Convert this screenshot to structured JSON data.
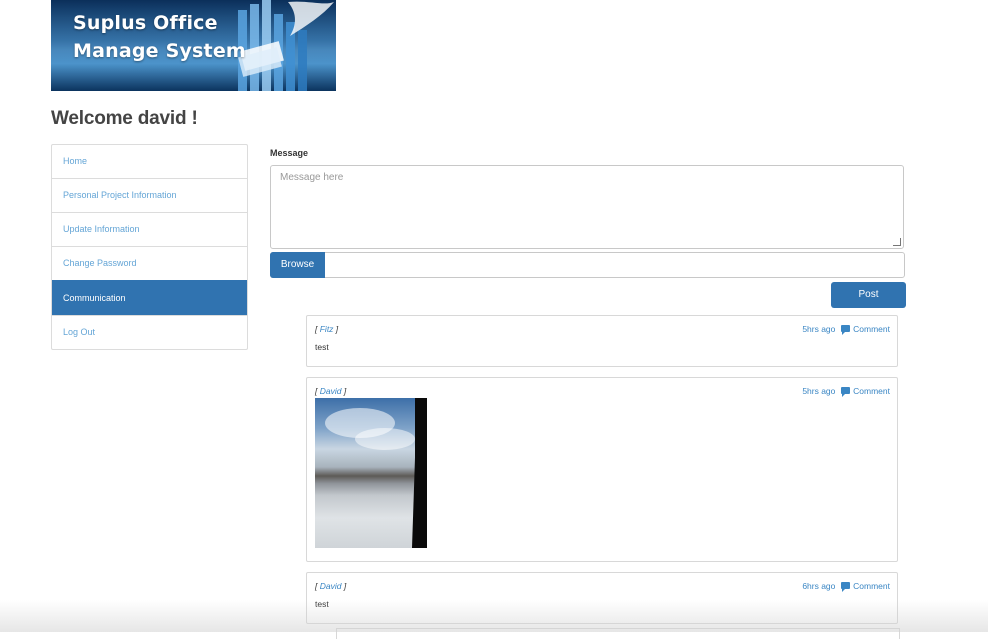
{
  "banner": {
    "line1": "Suplus Office",
    "line2": "Manage System"
  },
  "welcome": "Welcome david !",
  "sidebar": {
    "items": [
      {
        "label": "Home"
      },
      {
        "label": "Personal Project Information"
      },
      {
        "label": "Update Information"
      },
      {
        "label": "Change Password"
      },
      {
        "label": "Communication",
        "active": true
      },
      {
        "label": "Log Out"
      }
    ]
  },
  "form": {
    "message_label": "Message",
    "message_placeholder": "Message here",
    "browse_label": "Browse",
    "post_label": "Post"
  },
  "posts": [
    {
      "bracket_open": "[ ",
      "author": "Fitz",
      "bracket_close": " ]",
      "time": "5hrs ago",
      "comment_label": "Comment",
      "body": "test"
    },
    {
      "bracket_open": "[ ",
      "author": "David",
      "bracket_close": " ]",
      "time": "5hrs ago",
      "comment_label": "Comment",
      "body": ""
    },
    {
      "bracket_open": "[ ",
      "author": "David",
      "bracket_close": " ]",
      "time": "6hrs ago",
      "comment_label": "Comment",
      "body": "test"
    }
  ],
  "colors": {
    "primary": "#3073b0",
    "link": "#3a86c4",
    "sidebar_link": "#64a5d6"
  }
}
